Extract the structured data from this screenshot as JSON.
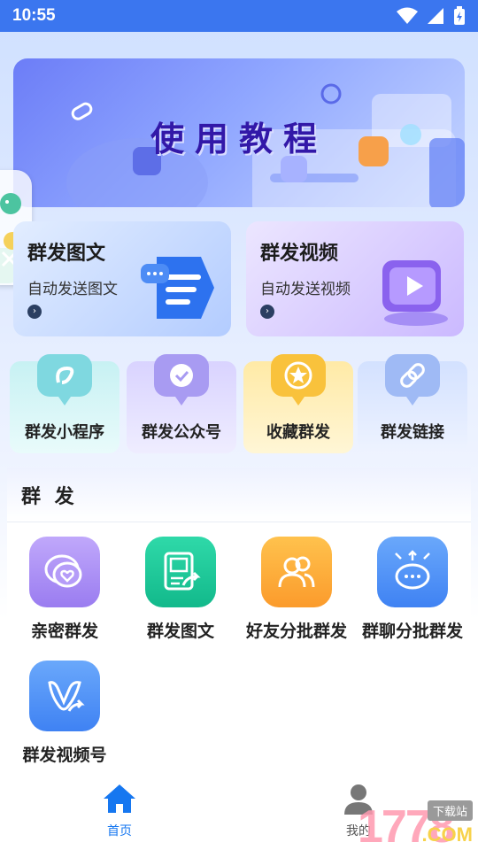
{
  "status_bar": {
    "time": "10:55"
  },
  "banner": {
    "title": "使用教程"
  },
  "cards": [
    {
      "title": "群发图文",
      "subtitle": "自动发送图文"
    },
    {
      "title": "群发视频",
      "subtitle": "自动发送视频"
    }
  ],
  "features": [
    {
      "label": "群发小程序",
      "color": "#c7f1f3"
    },
    {
      "label": "群发公众号",
      "color": "#e7e3ff"
    },
    {
      "label": "收藏群发",
      "color": "#fff2c4"
    },
    {
      "label": "群发链接",
      "color": "#dfe9ff"
    }
  ],
  "section": {
    "title": "群 发",
    "items": [
      {
        "label": "亲密群发",
        "icon": "chat-heart-icon",
        "color": "#a98cf3"
      },
      {
        "label": "群发图文",
        "icon": "image-share-icon",
        "color": "#1dc79a"
      },
      {
        "label": "好友分批群发",
        "icon": "friends-icon",
        "color": "#fca83c"
      },
      {
        "label": "群聊分批群发",
        "icon": "group-chat-icon",
        "color": "#4b8df6"
      },
      {
        "label": "群发视频号",
        "icon": "video-channel-icon",
        "color": "#4b8df6"
      }
    ]
  },
  "tabbar": {
    "home": "首页",
    "mine": "我的"
  },
  "watermark": {
    "text": "1778",
    "tag": "下载站",
    "suffix": ".COM"
  }
}
